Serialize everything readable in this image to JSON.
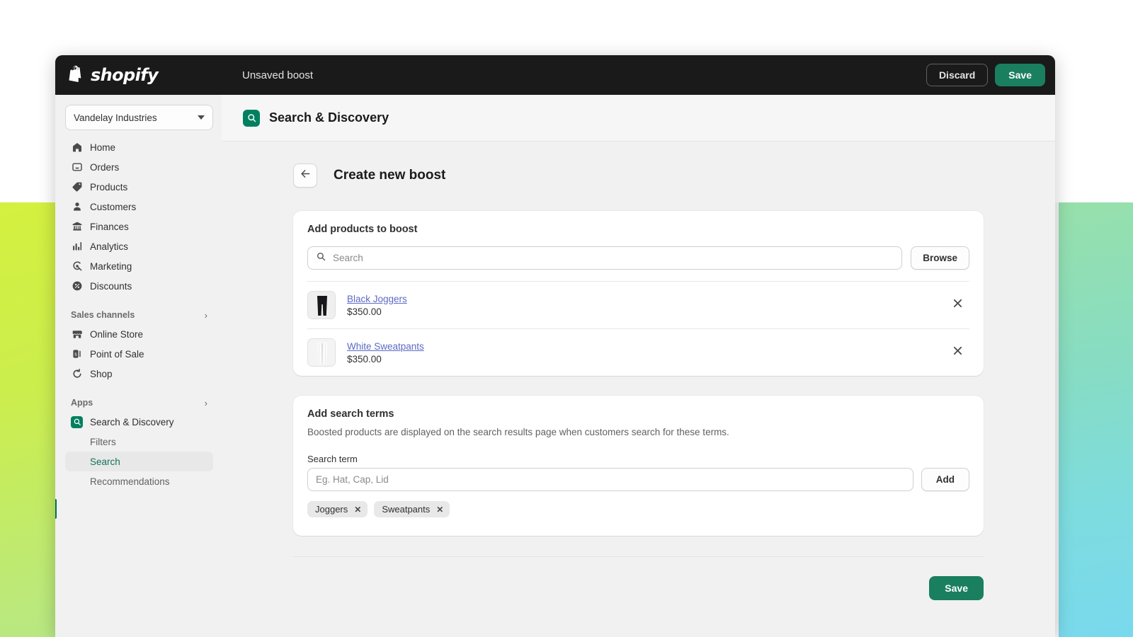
{
  "topbar": {
    "logo_icon": "shopify-bag-icon",
    "brand": "shopify",
    "title": "Unsaved boost",
    "discard_label": "Discard",
    "save_label": "Save"
  },
  "sidebar": {
    "store": {
      "name": "Vandelay Industries",
      "caret_icon": "chevron-down-icon"
    },
    "items": [
      {
        "label": "Home",
        "icon": "home-icon"
      },
      {
        "label": "Orders",
        "icon": "orders-inbox-icon"
      },
      {
        "label": "Products",
        "icon": "product-tag-icon"
      },
      {
        "label": "Customers",
        "icon": "person-icon"
      },
      {
        "label": "Finances",
        "icon": "bank-icon"
      },
      {
        "label": "Analytics",
        "icon": "bar-chart-icon"
      },
      {
        "label": "Marketing",
        "icon": "megaphone-target-icon"
      },
      {
        "label": "Discounts",
        "icon": "discount-percent-icon"
      }
    ],
    "sections": [
      {
        "label": "Sales channels",
        "chevron_icon": "chevron-right-icon",
        "items": [
          {
            "label": "Online Store",
            "icon": "storefront-icon"
          },
          {
            "label": "Point of Sale",
            "icon": "pos-terminal-icon"
          },
          {
            "label": "Shop",
            "icon": "shop-bag-icon"
          }
        ]
      },
      {
        "label": "Apps",
        "chevron_icon": "chevron-right-icon",
        "items": [
          {
            "label": "Search & Discovery",
            "icon": "search-discovery-app-icon"
          }
        ],
        "sub_items": [
          {
            "label": "Filters",
            "active": false
          },
          {
            "label": "Search",
            "active": true
          },
          {
            "label": "Recommendations",
            "active": false
          }
        ]
      }
    ]
  },
  "page_header": {
    "app_icon": "search-discovery-app-icon",
    "title": "Search & Discovery"
  },
  "boost": {
    "back_icon": "arrow-left-icon",
    "title": "Create new boost"
  },
  "products_card": {
    "title": "Add products to boost",
    "search_icon": "search-icon",
    "search_placeholder": "Search",
    "search_value": "",
    "browse_label": "Browse",
    "remove_icon": "close-x-icon",
    "rows": [
      {
        "name": "Black Joggers",
        "price": "$350.00",
        "thumb": "black-joggers-thumb"
      },
      {
        "name": "White Sweatpants",
        "price": "$350.00",
        "thumb": "white-sweatpants-thumb"
      }
    ]
  },
  "terms_card": {
    "title": "Add search terms",
    "description": "Boosted products are displayed on the search results page when customers search for these terms.",
    "field_label": "Search term",
    "input_placeholder": "Eg. Hat, Cap, Lid",
    "input_value": "",
    "add_label": "Add",
    "tag_remove_icon": "close-x-icon",
    "tags": [
      {
        "label": "Joggers"
      },
      {
        "label": "Sweatpants"
      }
    ]
  },
  "footer": {
    "save_label": "Save"
  },
  "colors": {
    "brand_green": "#008060",
    "save_green": "#1a7f5f",
    "active_green": "#11715a",
    "active_bar": "#00705a",
    "link_blue": "#5c6ac4",
    "topbar_black": "#1a1a1a",
    "sidebar_gray": "#f1f1f1",
    "bg_left_gradient": "#cbee4e",
    "bg_right_gradient": "#79d9ed"
  }
}
